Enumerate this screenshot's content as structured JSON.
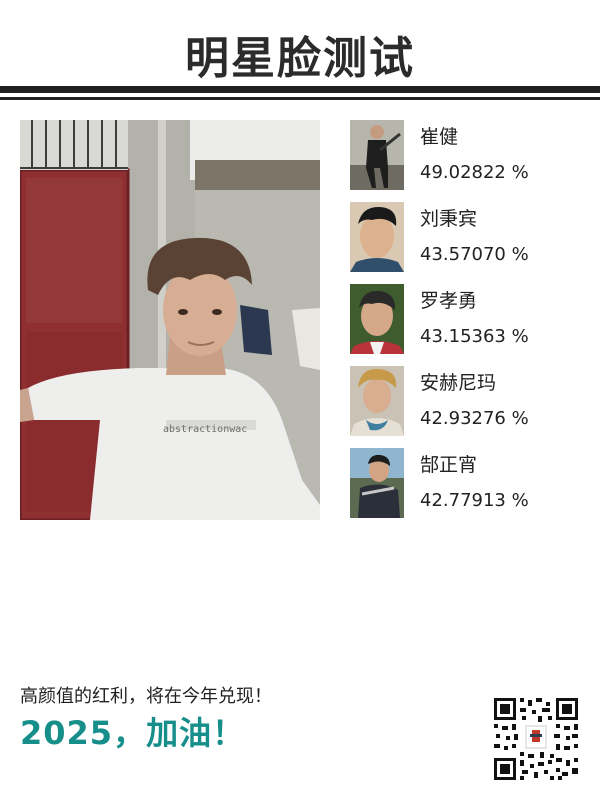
{
  "header": {
    "title": "明星脸测试"
  },
  "photo": {
    "shirt_text": "abstractionwac"
  },
  "results": [
    {
      "name": "崔健",
      "score": "49.02822 %"
    },
    {
      "name": "刘秉宾",
      "score": "43.57070 %"
    },
    {
      "name": "罗孝勇",
      "score": "43.15363 %"
    },
    {
      "name": "安赫尼玛",
      "score": "42.93276 %"
    },
    {
      "name": "郜正宵",
      "score": "42.77913 %"
    }
  ],
  "footer": {
    "slogan": "高颜值的红利，将在今年兑现！",
    "headline": "2025，加油！"
  },
  "colors": {
    "accent": "#168e8a",
    "rule": "#1f1f1f"
  }
}
